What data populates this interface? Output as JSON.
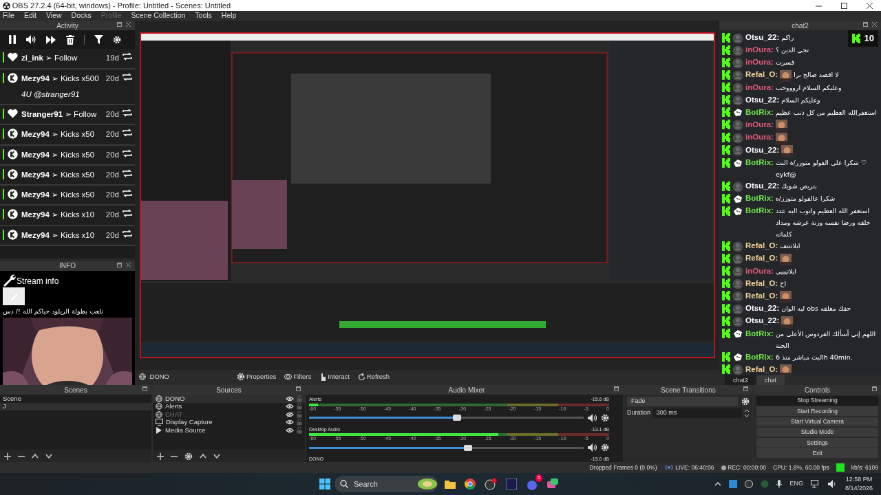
{
  "window": {
    "title": "OBS 27.2.4 (64-bit, windows) - Profile: Untitled - Scenes: Untitled"
  },
  "menu": [
    {
      "label": "File",
      "disabled": false
    },
    {
      "label": "Edit",
      "disabled": false
    },
    {
      "label": "View",
      "disabled": false
    },
    {
      "label": "Docks",
      "disabled": false
    },
    {
      "label": "Profile",
      "disabled": true
    },
    {
      "label": "Scene Collection",
      "disabled": false
    },
    {
      "label": "Tools",
      "disabled": false
    },
    {
      "label": "Help",
      "disabled": false
    }
  ],
  "activity": {
    "title": "Activity",
    "separator": "➢",
    "items": [
      {
        "kind": "follow",
        "user": "zi_ink",
        "action": "Follow",
        "time": "19d"
      },
      {
        "kind": "kicks",
        "user": "Mezy94",
        "action": "Kicks x500",
        "time": "20d",
        "note": "4U @stranger91"
      },
      {
        "kind": "follow",
        "user": "Stranger91",
        "action": "Follow",
        "time": "20d"
      },
      {
        "kind": "kicks",
        "user": "Mezy94",
        "action": "Kicks x50",
        "time": "20d"
      },
      {
        "kind": "kicks",
        "user": "Mezy94",
        "action": "Kicks x50",
        "time": "20d"
      },
      {
        "kind": "kicks",
        "user": "Mezy94",
        "action": "Kicks x50",
        "time": "20d"
      },
      {
        "kind": "kicks",
        "user": "Mezy94",
        "action": "Kicks x50",
        "time": "20d"
      },
      {
        "kind": "kicks",
        "user": "Mezy94",
        "action": "Kicks x10",
        "time": "20d"
      },
      {
        "kind": "kicks",
        "user": "Mezy94",
        "action": "Kicks x10",
        "time": "20d"
      }
    ]
  },
  "info": {
    "title": "INFO",
    "heading": "Stream info",
    "text": "نلعب بطولة الريلود حياكم الله !/ دس"
  },
  "preview_toolbar": {
    "source": "DONO",
    "buttons": [
      "Properties",
      "Filters",
      "Interact",
      "Refresh"
    ]
  },
  "chat": {
    "title": "chat2",
    "viewers": "10",
    "messages": [
      {
        "user": "Otsu_22:",
        "color": "#ffffff",
        "kind": "user",
        "text": "راكم",
        "emote": false
      },
      {
        "user": "inOura:",
        "color": "#e05a7a",
        "kind": "user",
        "text": "تجي الدين ؟",
        "emote": false
      },
      {
        "user": "inOura:",
        "color": "#e05a7a",
        "kind": "user",
        "text": "قسرت",
        "emote": false
      },
      {
        "user": "Refal_O:",
        "color": "#f2d49b",
        "kind": "user",
        "text": "لا اقصد صالح برا",
        "emote": true
      },
      {
        "user": "inOura:",
        "color": "#e05a7a",
        "kind": "user",
        "text": "وعليكم السلام اروووحب",
        "emote": false
      },
      {
        "user": "Otsu_22:",
        "color": "#ffffff",
        "kind": "user",
        "text": "وعليكم السلام",
        "emote": false
      },
      {
        "user": "BotRix:",
        "color": "#6fe24a",
        "kind": "bot",
        "text": "استغفرالله العظيم من كل ذنب عظيم",
        "emote": false
      },
      {
        "user": "inOura:",
        "color": "#e05a7a",
        "kind": "user",
        "emote": true
      },
      {
        "user": "inOura:",
        "color": "#e05a7a",
        "kind": "user",
        "emote": true
      },
      {
        "user": "Otsu_22:",
        "color": "#ffffff",
        "kind": "user",
        "emote": true
      },
      {
        "user": "BotRix:",
        "color": "#6fe24a",
        "kind": "bot",
        "text": "شكرا على الفولو متوزر/ة البث ♡ eykf@",
        "emote": false
      },
      {
        "user": "Otsu_22:",
        "color": "#ffffff",
        "kind": "user",
        "text": "بتريص شويك",
        "emote": false
      },
      {
        "user": "BotRix:",
        "color": "#6fe24a",
        "kind": "bot",
        "text": "شكرا عالفولو متوزز/ه",
        "emote": false
      },
      {
        "user": "BotRix:",
        "color": "#6fe24a",
        "kind": "bot",
        "text": "استغفر الله العظيم واتوب اليه عدد خلقه ورضا نفسه وزنة عرشه ومداد كلماته",
        "emote": false
      },
      {
        "user": "Refal_O:",
        "color": "#f2d49b",
        "kind": "user",
        "text": "ايلاتتتف",
        "emote": false
      },
      {
        "user": "Refal_O:",
        "color": "#f2d49b",
        "kind": "user",
        "emote": true
      },
      {
        "user": "inOura:",
        "color": "#e05a7a",
        "kind": "user",
        "text": "ايلاتيييي",
        "emote": false
      },
      {
        "user": "Refal_O:",
        "color": "#f2d49b",
        "kind": "user",
        "text": "اح",
        "emote": false
      },
      {
        "user": "Refal_O:",
        "color": "#f2d49b",
        "kind": "user",
        "emote": true
      },
      {
        "user": "Otsu_22:",
        "color": "#ffffff",
        "kind": "user",
        "text": "ليه الوان obs حقك معلقه",
        "emote": false
      },
      {
        "user": "Otsu_22:",
        "color": "#ffffff",
        "kind": "user",
        "emote": true
      },
      {
        "user": "BotRix:",
        "color": "#6fe24a",
        "kind": "bot",
        "text": "اللهم إني أسألك الفردوس الأعلى من الجنة",
        "emote": false
      },
      {
        "user": "BotRix:",
        "color": "#6fe24a",
        "kind": "bot",
        "text": "البث مباشر منذ 6h 40min.",
        "emote": false
      },
      {
        "user": "Refal_O:",
        "color": "#f2d49b",
        "kind": "user",
        "emote": true
      }
    ],
    "tabs": [
      {
        "label": "chat2",
        "selected": true
      },
      {
        "label": "chat",
        "selected": false
      }
    ]
  },
  "scenes": {
    "title": "Scenes",
    "items": [
      {
        "label": "Scene",
        "selected": false
      },
      {
        "label": "J",
        "selected": true
      }
    ]
  },
  "sources": {
    "title": "Sources",
    "items": [
      {
        "kind": "browser",
        "label": "DONO",
        "visible": true,
        "selected": true
      },
      {
        "kind": "browser",
        "label": "Alerts",
        "visible": true,
        "selected": false
      },
      {
        "kind": "browser",
        "label": "CHAT",
        "visible": false,
        "selected": false
      },
      {
        "kind": "display",
        "label": "Display Capture",
        "visible": true,
        "selected": false
      },
      {
        "kind": "media",
        "label": "Media Source",
        "visible": true,
        "selected": false
      }
    ]
  },
  "mixer": {
    "title": "Audio Mixer",
    "channels": [
      {
        "name": "Alerts",
        "reading": "-15.6 dB",
        "level": 0.03,
        "volume": {
          "level": 0.54
        },
        "ticks": [
          "-60",
          "-55",
          "-50",
          "-45",
          "-40",
          "-35",
          "-30",
          "-25",
          "-20",
          "-15",
          "-10",
          "-5",
          "0"
        ]
      },
      {
        "name": "Desktop Audio",
        "reading": "-13.1 dB",
        "level": 0.63,
        "volume": {
          "level": 0.58
        },
        "ticks": [
          "-60",
          "-55",
          "-50",
          "-45",
          "-40",
          "-35",
          "-30",
          "-25",
          "-20",
          "-15",
          "-10",
          "-5",
          "0"
        ]
      },
      {
        "name": "DONO",
        "reading": "-15.0 dB"
      }
    ]
  },
  "transitions": {
    "title": "Scene Transitions",
    "type": "Fade",
    "duration_label": "Duration",
    "duration": "300 ms"
  },
  "controls": {
    "title": "Controls",
    "buttons": [
      {
        "label": "Stop Streaming",
        "active": true
      },
      {
        "label": "Start Recording",
        "active": false
      },
      {
        "label": "Start Virtual Camera",
        "active": false
      },
      {
        "label": "Studio Mode",
        "active": false
      },
      {
        "label": "Settings",
        "active": false
      },
      {
        "label": "Exit",
        "active": false
      }
    ]
  },
  "status_bar": {
    "dropped": "Dropped Frames 0 (0.0%)",
    "live": "LIVE: 06:40:06",
    "rec": "REC: 00:00:00",
    "cpu": "CPU: 1.8%, 60.00 fps",
    "bitrate": "kb/s: 6109"
  },
  "taskbar": {
    "search": "Search",
    "discord_badge": "5",
    "language": "ENG",
    "time": "12:58 PM",
    "date": "8/14/2026"
  }
}
